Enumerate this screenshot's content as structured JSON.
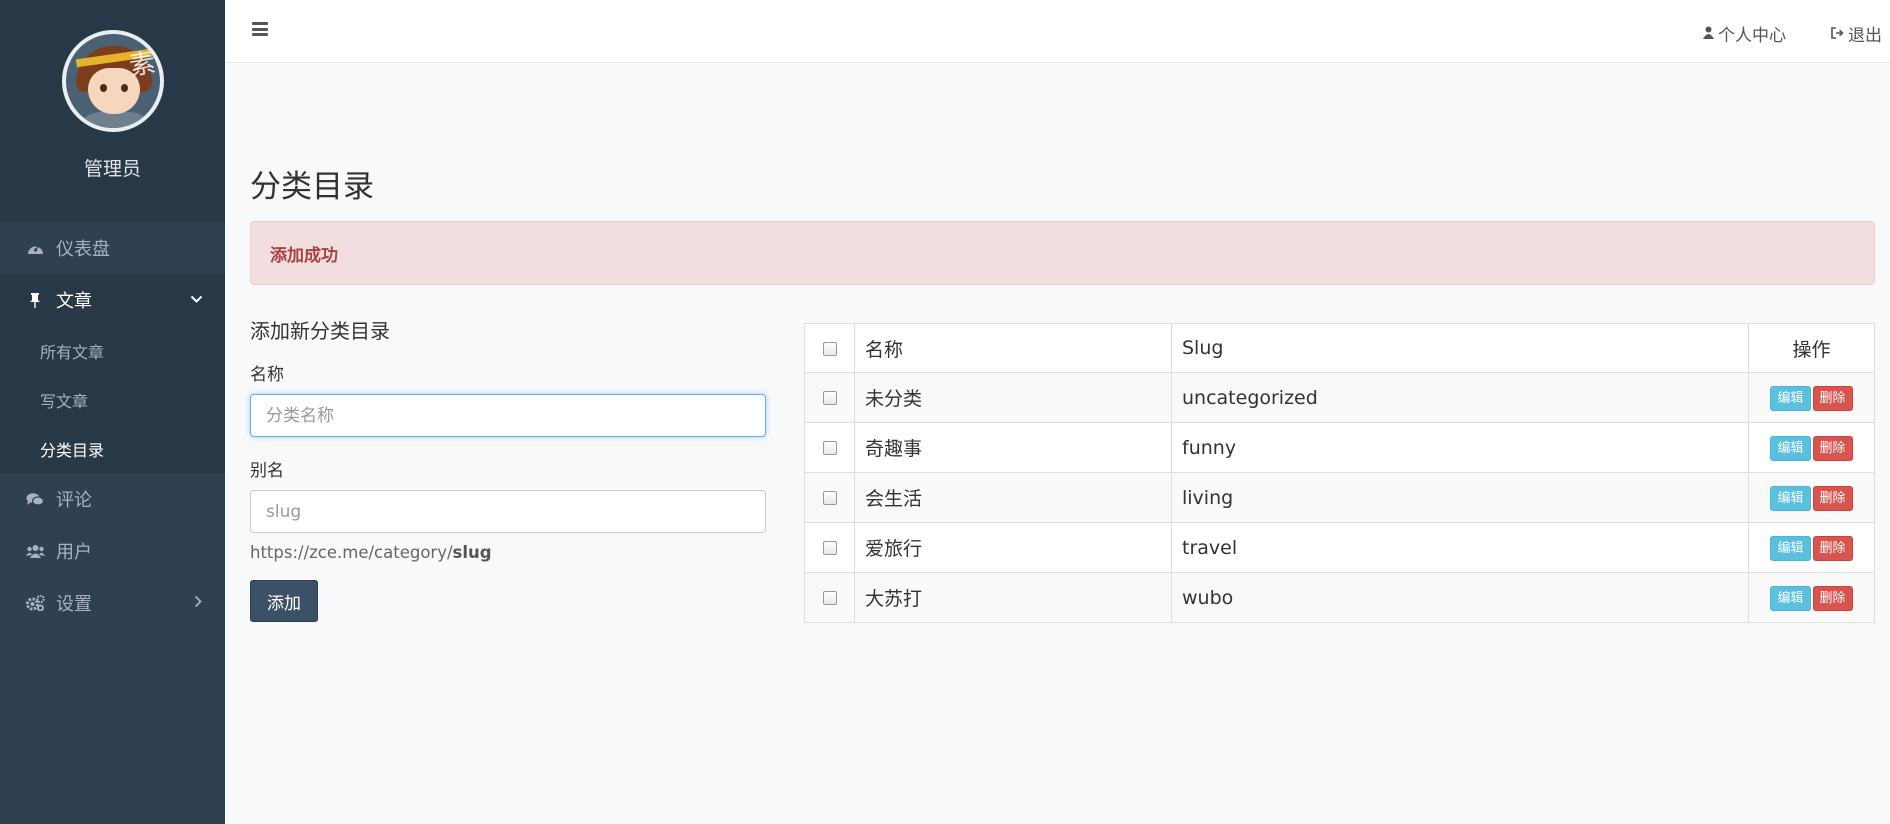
{
  "sidebar": {
    "username": "管理员",
    "nav": [
      {
        "label": "仪表盘",
        "icon": "dashboard-icon"
      },
      {
        "label": "文章",
        "icon": "pin-icon",
        "expanded": true,
        "children": [
          "所有文章",
          "写文章",
          "分类目录"
        ]
      },
      {
        "label": "评论",
        "icon": "comments-icon"
      },
      {
        "label": "用户",
        "icon": "users-icon"
      },
      {
        "label": "设置",
        "icon": "settings-icon"
      }
    ]
  },
  "topbar": {
    "profile": "个人中心",
    "logout": "退出"
  },
  "page": {
    "title": "分类目录",
    "alert": "添加成功"
  },
  "form": {
    "title": "添加新分类目录",
    "name_label": "名称",
    "name_placeholder": "分类名称",
    "slug_label": "别名",
    "slug_placeholder": "slug",
    "help_prefix": "https://zce.me/category/",
    "help_bold": "slug",
    "submit": "添加"
  },
  "table": {
    "headers": {
      "name": "名称",
      "slug": "Slug",
      "ops": "操作"
    },
    "edit_label": "编辑",
    "delete_label": "删除",
    "rows": [
      {
        "name": "未分类",
        "slug": "uncategorized"
      },
      {
        "name": "奇趣事",
        "slug": "funny"
      },
      {
        "name": "会生活",
        "slug": "living"
      },
      {
        "name": "爱旅行",
        "slug": "travel"
      },
      {
        "name": "大苏打",
        "slug": "wubo"
      }
    ]
  },
  "colors": {
    "sidebar_bg": "#2f4050",
    "sidebar_dark": "#293846",
    "alert_bg": "#f2dede",
    "alert_text": "#a94442",
    "primary_btn": "#3c5066",
    "info_btn": "#5bc0de",
    "danger_btn": "#d9534f"
  }
}
